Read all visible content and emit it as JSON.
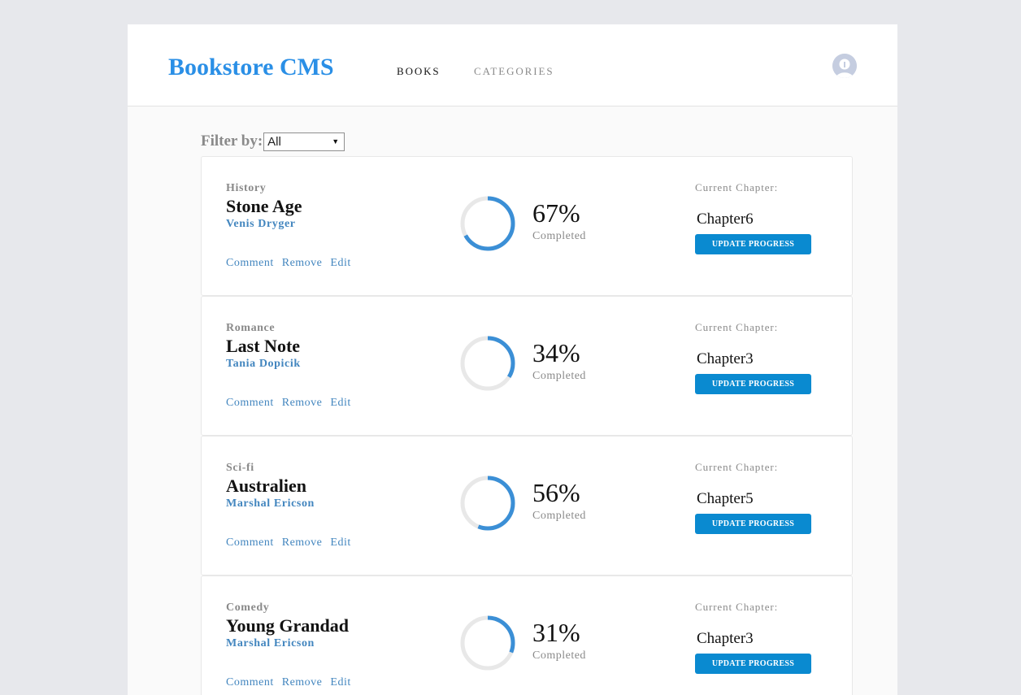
{
  "header": {
    "brand": "Bookstore CMS",
    "nav": [
      {
        "label": "BOOKS"
      },
      {
        "label": "CATEGORIES"
      }
    ]
  },
  "filter": {
    "label": "Filter by:",
    "selected": "All"
  },
  "colors": {
    "brand": "#2a8fe6",
    "link": "#4386bf",
    "progress_arc": "#3b8fd6",
    "progress_track": "#e8e8e8",
    "button": "#0a8ad0"
  },
  "books": [
    {
      "category": "History",
      "title": "Stone Age",
      "author": "Venis Dryger",
      "actions": [
        "Comment",
        "Remove",
        "Edit"
      ],
      "progress": 67,
      "percent_text": "67%",
      "completed_label": "Completed",
      "chapter_label": "Current Chapter:",
      "chapter": "Chapter6",
      "button_label": "UPDATE PROGRESS"
    },
    {
      "category": "Romance",
      "title": "Last Note",
      "author": "Tania Dopicik",
      "actions": [
        "Comment",
        "Remove",
        "Edit"
      ],
      "progress": 34,
      "percent_text": "34%",
      "completed_label": "Completed",
      "chapter_label": "Current Chapter:",
      "chapter": "Chapter3",
      "button_label": "UPDATE PROGRESS"
    },
    {
      "category": "Sci-fi",
      "title": "Australien",
      "author": "Marshal Ericson",
      "actions": [
        "Comment",
        "Remove",
        "Edit"
      ],
      "progress": 56,
      "percent_text": "56%",
      "completed_label": "Completed",
      "chapter_label": "Current Chapter:",
      "chapter": "Chapter5",
      "button_label": "UPDATE PROGRESS"
    },
    {
      "category": "Comedy",
      "title": "Young Grandad",
      "author": "Marshal Ericson",
      "actions": [
        "Comment",
        "Remove",
        "Edit"
      ],
      "progress": 31,
      "percent_text": "31%",
      "completed_label": "Completed",
      "chapter_label": "Current Chapter:",
      "chapter": "Chapter3",
      "button_label": "UPDATE PROGRESS"
    }
  ]
}
